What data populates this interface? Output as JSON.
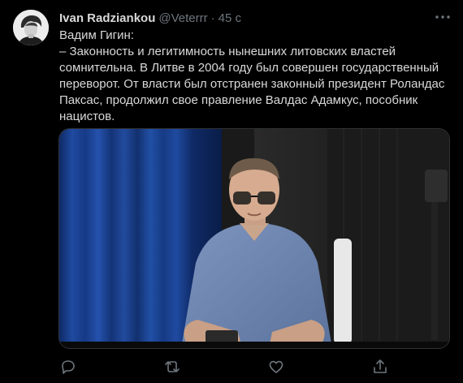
{
  "author": {
    "name": "Ivan Radziankou",
    "handle": "@Veterrr",
    "separator": "·",
    "time": "45 с"
  },
  "tweet": {
    "lines": [
      "Вадим Гигин:",
      "– Законность и легитимность нынешних литовских властей",
      "сомнительна. В Литве в 2004 году был совершен государственный",
      "переворот. От власти был отстранен законный президент Роландас",
      "Паксас, продолжил свое правление Валдас Адамкус, пособник",
      "нацистов."
    ]
  },
  "icons": {
    "more": "more-options-icon",
    "reply": "reply-icon",
    "retweet": "retweet-icon",
    "like": "like-icon",
    "share": "share-icon"
  },
  "colors": {
    "background": "#000000",
    "text": "#d9d9d9",
    "secondary": "#6e767d",
    "curtain_blue": "#1c3f8a"
  }
}
